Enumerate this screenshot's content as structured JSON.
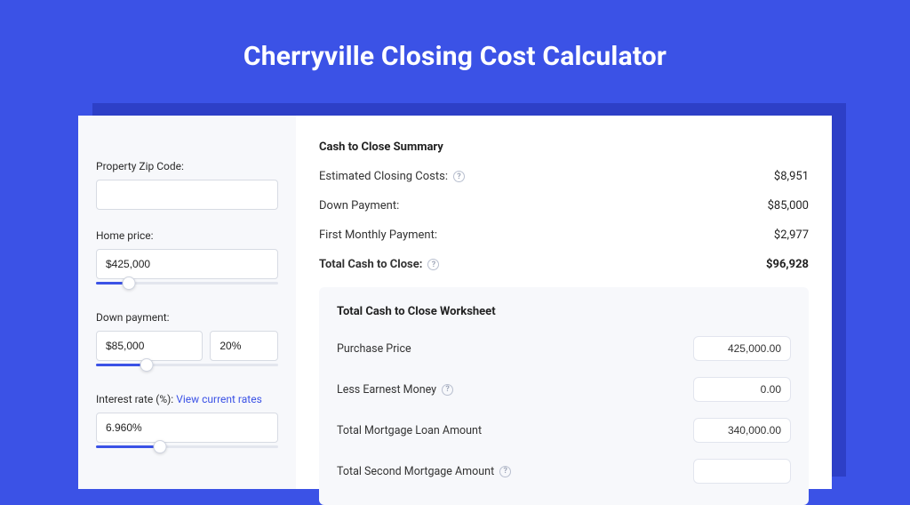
{
  "page_title": "Cherryville Closing Cost Calculator",
  "left": {
    "zip_label": "Property Zip Code:",
    "zip_value": "",
    "home_price_label": "Home price:",
    "home_price_value": "$425,000",
    "home_price_slider_pct": 18,
    "down_payment_label": "Down payment:",
    "down_payment_value": "$85,000",
    "down_payment_pct_value": "20%",
    "down_payment_slider_pct": 28,
    "interest_label_prefix": "Interest rate (%): ",
    "interest_link": "View current rates",
    "interest_value": "6.960%",
    "interest_slider_pct": 35
  },
  "summary": {
    "title": "Cash to Close Summary",
    "closing_costs_label": "Estimated Closing Costs:",
    "closing_costs_value": "$8,951",
    "down_payment_label": "Down Payment:",
    "down_payment_value": "$85,000",
    "first_payment_label": "First Monthly Payment:",
    "first_payment_value": "$2,977",
    "total_label": "Total Cash to Close:",
    "total_value": "$96,928"
  },
  "worksheet": {
    "title": "Total Cash to Close Worksheet",
    "purchase_price_label": "Purchase Price",
    "purchase_price_value": "425,000.00",
    "earnest_label": "Less Earnest Money",
    "earnest_value": "0.00",
    "loan_amount_label": "Total Mortgage Loan Amount",
    "loan_amount_value": "340,000.00",
    "second_mortgage_label": "Total Second Mortgage Amount"
  },
  "help_glyph": "?"
}
